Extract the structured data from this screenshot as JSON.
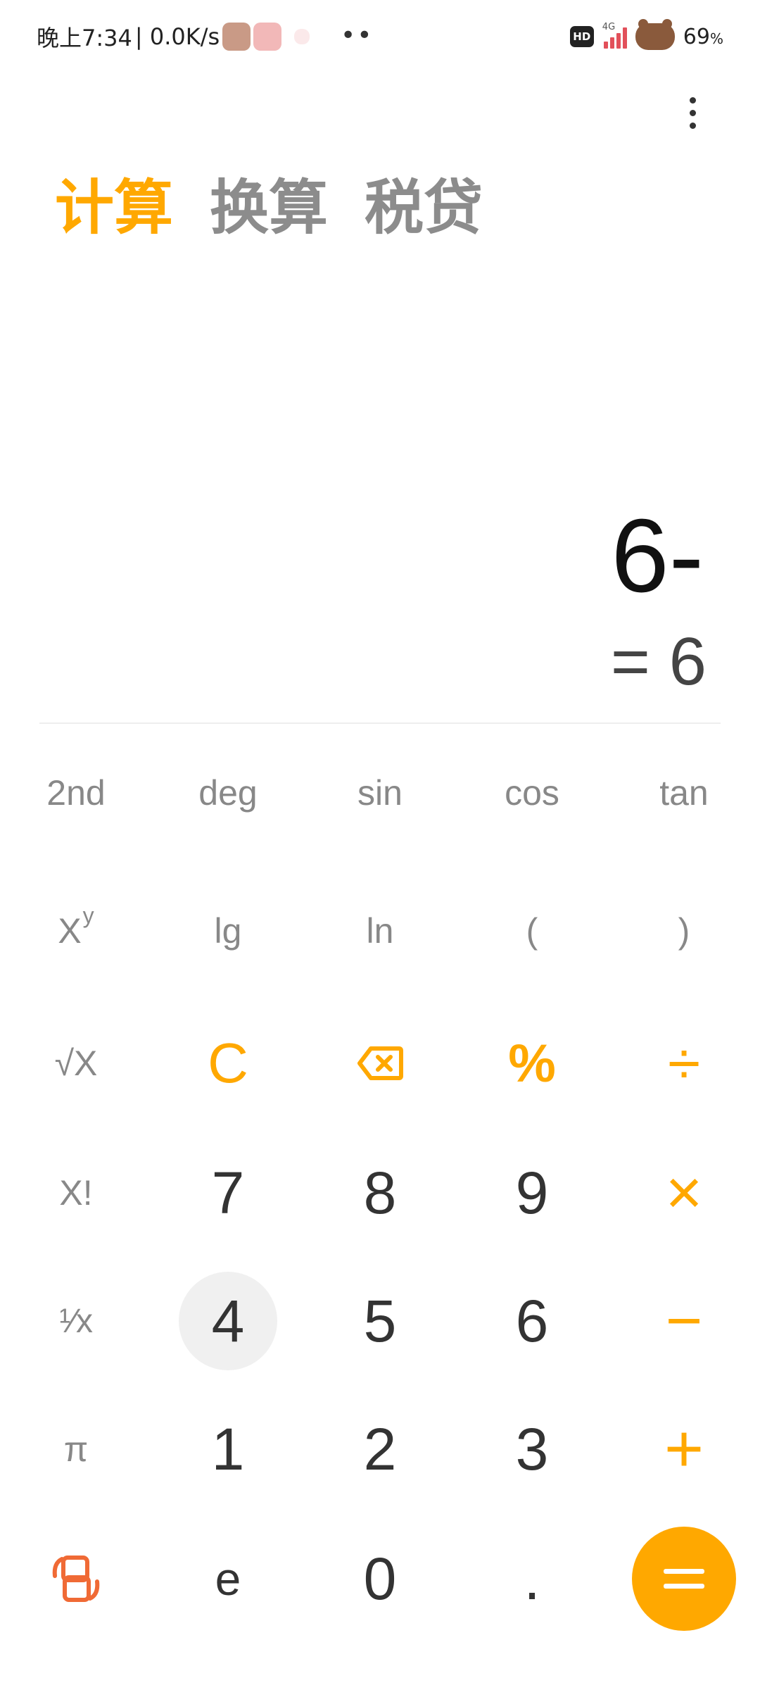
{
  "status_bar": {
    "time": "晚上7:34",
    "net_speed": "| 0.0K/s",
    "dots": "••",
    "hd": "HD",
    "network": "4G",
    "battery": "69",
    "battery_unit": "%"
  },
  "tabs": [
    {
      "label": "计算",
      "active": true
    },
    {
      "label": "换算",
      "active": false
    },
    {
      "label": "税贷",
      "active": false
    }
  ],
  "display": {
    "expression": "6-",
    "result": "= 6"
  },
  "keys": {
    "second": "2nd",
    "deg": "deg",
    "sin": "sin",
    "cos": "cos",
    "tan": "tan",
    "pow_base": "X",
    "pow_exp": "y",
    "lg": "lg",
    "ln": "ln",
    "lparen": "(",
    "rparen": ")",
    "sqrt": "√X",
    "clear": "C",
    "percent": "%",
    "divide": "÷",
    "factorial": "X!",
    "n7": "7",
    "n8": "8",
    "n9": "9",
    "multiply": "×",
    "reciprocal": "¹⁄x",
    "n4": "4",
    "n5": "5",
    "n6": "6",
    "minus": "−",
    "pi": "π",
    "n1": "1",
    "n2": "2",
    "n3": "3",
    "plus": "+",
    "e": "e",
    "n0": "0",
    "dot": "."
  },
  "colors": {
    "accent": "#ffa800",
    "switch_icon": "#f06a35"
  }
}
